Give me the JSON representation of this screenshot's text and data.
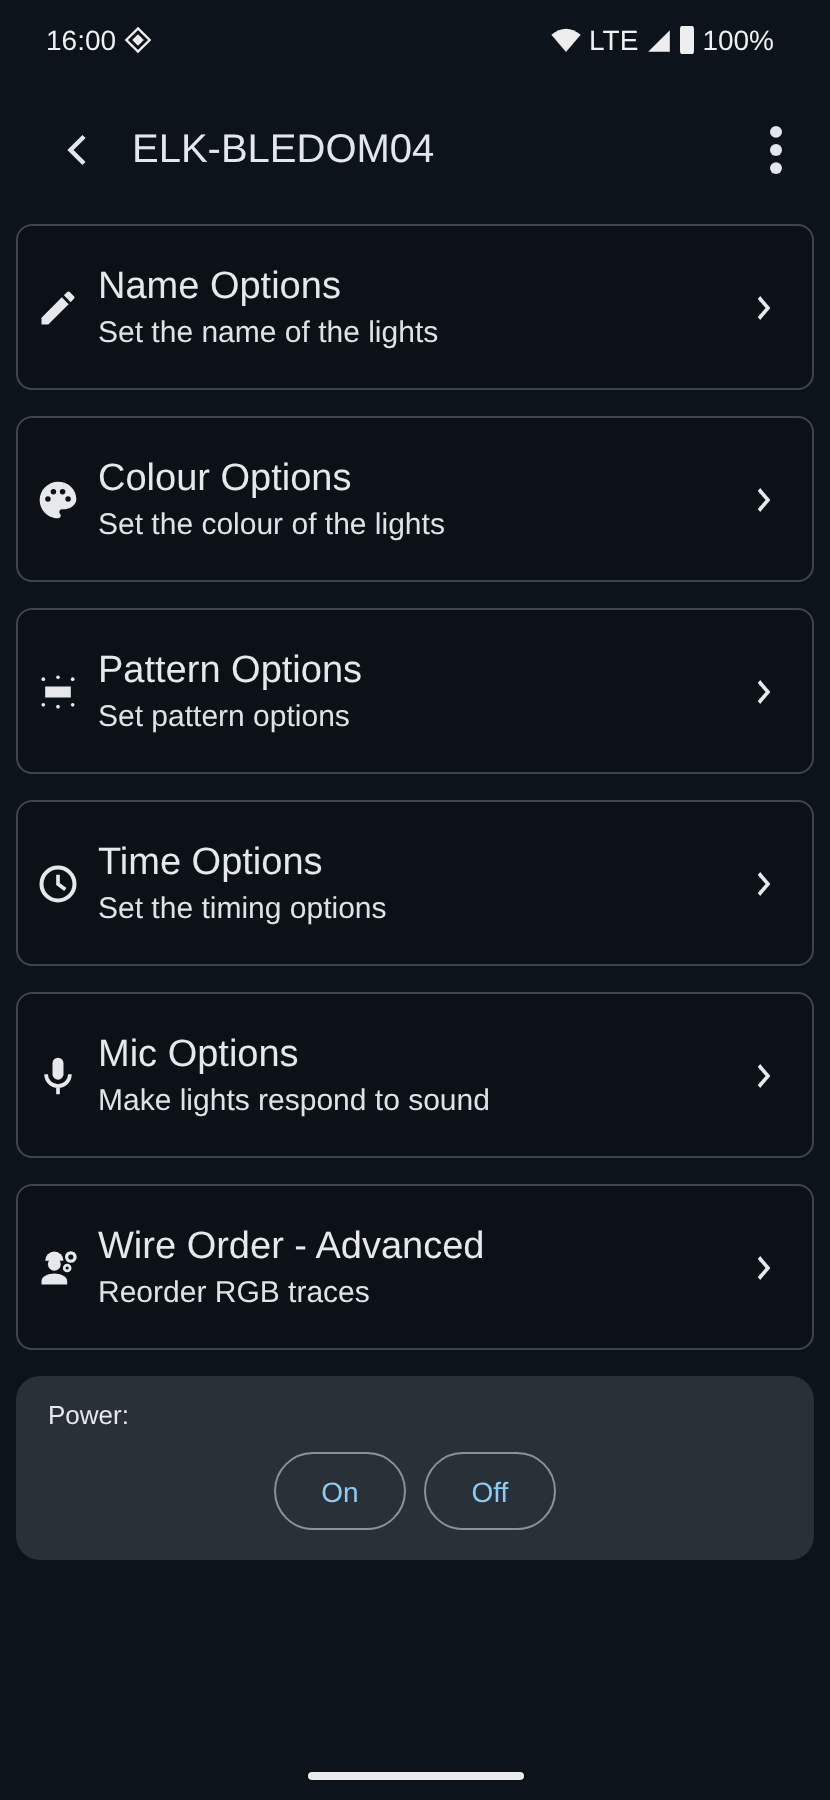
{
  "status_bar": {
    "time": "16:00",
    "network": "LTE",
    "battery": "100%"
  },
  "app_bar": {
    "title": "ELK-BLEDOM04"
  },
  "options": [
    {
      "title": "Name Options",
      "subtitle": "Set the name of the lights"
    },
    {
      "title": "Colour Options",
      "subtitle": "Set the colour of the lights"
    },
    {
      "title": "Pattern Options",
      "subtitle": "Set pattern options"
    },
    {
      "title": "Time Options",
      "subtitle": "Set the timing options"
    },
    {
      "title": "Mic Options",
      "subtitle": "Make lights respond to sound"
    },
    {
      "title": "Wire Order - Advanced",
      "subtitle": "Reorder RGB traces"
    }
  ],
  "power": {
    "label": "Power:",
    "buttons": [
      "On",
      "Off"
    ]
  }
}
